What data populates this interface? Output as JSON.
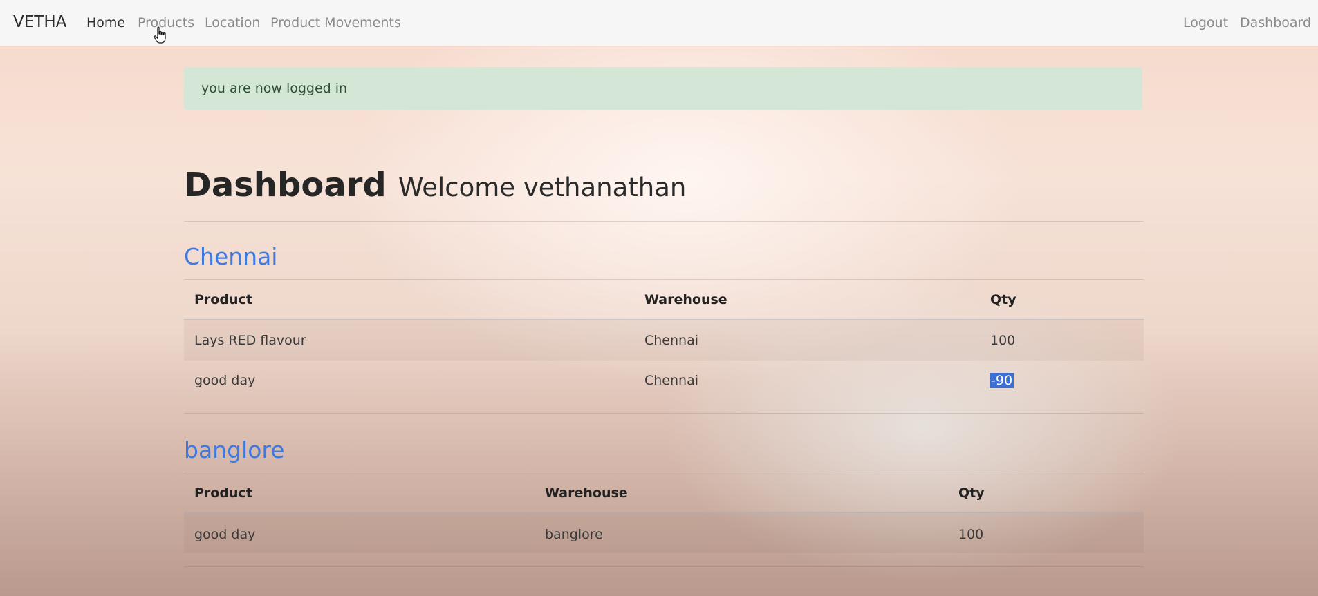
{
  "navbar": {
    "brand": "VETHA",
    "links": [
      {
        "label": "Home"
      },
      {
        "label": "Products"
      },
      {
        "label": "Location"
      },
      {
        "label": "Product Movements"
      }
    ],
    "right_links": [
      {
        "label": "Logout"
      },
      {
        "label": "Dashboard"
      }
    ]
  },
  "alert": {
    "message": "you are now logged in"
  },
  "page": {
    "title": "Dashboard",
    "subtitle": "Welcome vethanathan"
  },
  "locations": [
    {
      "name": "Chennai",
      "columns": [
        "Product",
        "Warehouse",
        "Qty"
      ],
      "rows": [
        {
          "product": "Lays RED flavour",
          "warehouse": "Chennai",
          "qty": "100"
        },
        {
          "product": "good day",
          "warehouse": "Chennai",
          "qty": "-90"
        }
      ]
    },
    {
      "name": "banglore",
      "columns": [
        "Product",
        "Warehouse",
        "Qty"
      ],
      "rows": [
        {
          "product": "good day",
          "warehouse": "banglore",
          "qty": "100"
        }
      ]
    }
  ],
  "colors": {
    "link_accent": "#3e7ae0",
    "alert_bg": "#d4e7d6",
    "selection": "#3b6fd6"
  }
}
